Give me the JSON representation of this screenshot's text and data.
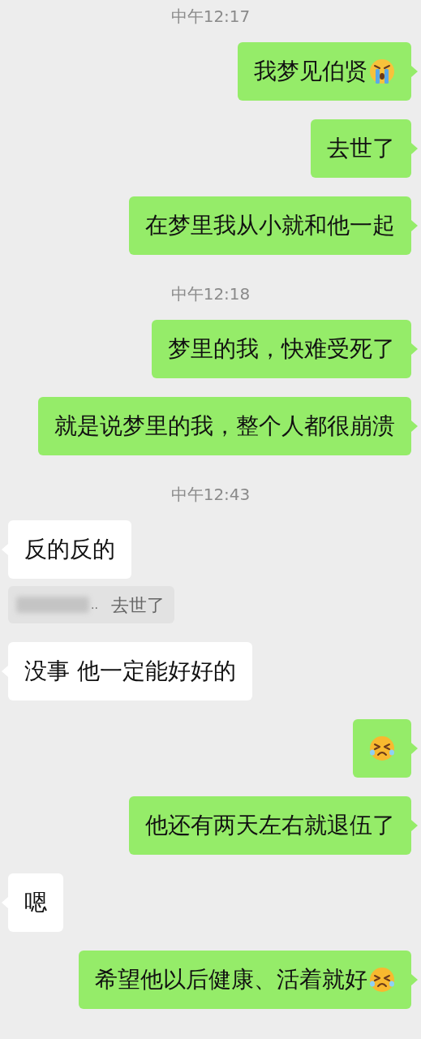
{
  "messages": [
    {
      "kind": "time",
      "text": "中午12:17"
    },
    {
      "kind": "message",
      "outgoing": true,
      "text": "我梦见伯贤",
      "emoji": {
        "kind": "crying"
      }
    },
    {
      "kind": "message",
      "outgoing": true,
      "text": "去世了"
    },
    {
      "kind": "message",
      "outgoing": true,
      "text": "在梦里我从小就和他一起"
    },
    {
      "kind": "time",
      "text": "中午12:18"
    },
    {
      "kind": "message",
      "outgoing": true,
      "text": "梦里的我，快难受死了"
    },
    {
      "kind": "message",
      "outgoing": true,
      "text": "就是说梦里的我，整个人都很崩溃"
    },
    {
      "kind": "time",
      "text": "中午12:43"
    },
    {
      "kind": "message",
      "outgoing": false,
      "text": "反的反的"
    },
    {
      "kind": "quote",
      "ellipsis": "..",
      "text": "去世了"
    },
    {
      "kind": "message",
      "outgoing": false,
      "text": "没事 他一定能好好的"
    },
    {
      "kind": "message",
      "outgoing": true,
      "emoji": {
        "kind": "squint-tears"
      }
    },
    {
      "kind": "message",
      "outgoing": true,
      "text": "他还有两天左右就退伍了"
    },
    {
      "kind": "message",
      "outgoing": false,
      "text": "嗯"
    },
    {
      "kind": "message",
      "outgoing": true,
      "text": "希望他以后健康、活着就好",
      "emoji": {
        "kind": "squint-tears"
      }
    }
  ]
}
